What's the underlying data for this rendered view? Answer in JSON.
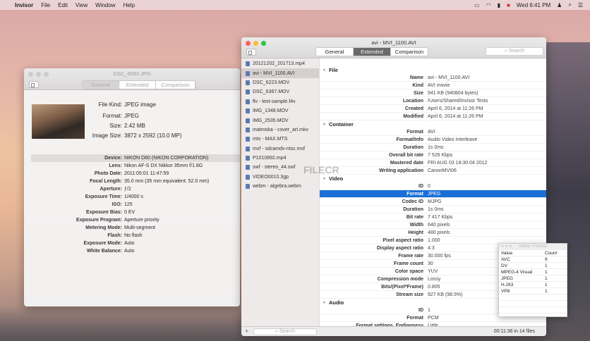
{
  "menubar": {
    "app": "Invisor",
    "items": [
      "File",
      "Edit",
      "View",
      "Window",
      "Help"
    ],
    "clock": "Wed 6:41 PM"
  },
  "left_window": {
    "title": "DSC_6093.JPG",
    "tabs": [
      "General",
      "Extended",
      "Comparison"
    ],
    "summary": [
      {
        "k": "File Kind:",
        "v": "JPEG image"
      },
      {
        "k": "Format:",
        "v": "JPEG"
      },
      {
        "k": "Size:",
        "v": "2.42 MB"
      },
      {
        "k": "Image Size:",
        "v": "3872 x 2592 (10.0 MP)"
      }
    ],
    "exif": [
      {
        "k": "Device:",
        "v": "NIKON D60 (NIKON CORPORATION)"
      },
      {
        "k": "Lens:",
        "v": "Nikon AF-S DX Nikkor 35mm f/1.8G"
      },
      {
        "k": "Photo Date:",
        "v": "2011:05:01 11:47:59"
      },
      {
        "k": "Focal Length:",
        "v": "35.0 mm (35 mm equivalent: 52.0 mm)"
      },
      {
        "k": "Aperture:",
        "v": "ƒ/2"
      },
      {
        "k": "Exposure Time:",
        "v": "1/4000 s"
      },
      {
        "k": "ISO:",
        "v": "125"
      },
      {
        "k": "Exposure Bias:",
        "v": "0 EV"
      },
      {
        "k": "Exposure Program:",
        "v": "Aperture priority"
      },
      {
        "k": "Metering Mode:",
        "v": "Multi-segment"
      },
      {
        "k": "Flash:",
        "v": "No flash"
      },
      {
        "k": "Exposure Mode:",
        "v": "Auto"
      },
      {
        "k": "White Balance:",
        "v": "Auto"
      }
    ]
  },
  "main_window": {
    "title": "avi - MVI_1100.AVI",
    "tabs": [
      "General",
      "Extended",
      "Comparison"
    ],
    "search_placeholder": "Search",
    "files": [
      "20121202_201713.mp4",
      "avi - MVI_1100.AVI",
      "DSC_6223.MOV",
      "DSC_6367.MOV",
      "flv - test-sample.f4v",
      "IMG_1348.MOV",
      "IMG_2535.MOV",
      "matroska - cover_art.mkv",
      "mts - MAX.MTS",
      "mxf - sdcamdv-ntsc.mxf",
      "P1010892.mp4",
      "swf - stereo_44.swf",
      "VIDEO0010.3gp",
      "webm - algebra.webm"
    ],
    "sidebar_search_placeholder": "Search",
    "status": "00:11:36 in 14 files",
    "sections": [
      {
        "name": "File",
        "rows": [
          {
            "k": "Name",
            "v": "avi - MVI_1100.AVI"
          },
          {
            "k": "Kind",
            "v": "AVI movie"
          },
          {
            "k": "Size",
            "v": "941 KB (940804 bytes)"
          },
          {
            "k": "Location",
            "v": "/Users/Shared/Invisor Tests"
          },
          {
            "k": "Created",
            "v": "April 6, 2014 at 11:26 PM"
          },
          {
            "k": "Modified",
            "v": "April 6, 2014 at 11:26 PM"
          }
        ]
      },
      {
        "name": "Container",
        "rows": [
          {
            "k": "Format",
            "v": "AVI"
          },
          {
            "k": "Format/Info",
            "v": "Audio Video Interleave"
          },
          {
            "k": "Duration",
            "v": "1s 0ms"
          },
          {
            "k": "Overall bit rate",
            "v": "7 526 Kbps"
          },
          {
            "k": "Mastered date",
            "v": "FRI AUG 03 18:30:04 2012"
          },
          {
            "k": "Writing application",
            "v": "CanonMVI06"
          }
        ]
      },
      {
        "name": "Video",
        "rows": [
          {
            "k": "ID",
            "v": "0"
          },
          {
            "k": "Format",
            "v": "JPEG"
          },
          {
            "k": "Codec ID",
            "v": "MJPG"
          },
          {
            "k": "Duration",
            "v": "1s 0ms"
          },
          {
            "k": "Bit rate",
            "v": "7 417 Kbps"
          },
          {
            "k": "Width",
            "v": "640 pixels"
          },
          {
            "k": "Height",
            "v": "480 pixels"
          },
          {
            "k": "Pixel aspect ratio",
            "v": "1.000"
          },
          {
            "k": "Display aspect ratio",
            "v": "4:3"
          },
          {
            "k": "Frame rate",
            "v": "30.000 fps"
          },
          {
            "k": "Frame count",
            "v": "30"
          },
          {
            "k": "Color space",
            "v": "YUV"
          },
          {
            "k": "Compression mode",
            "v": "Lossy"
          },
          {
            "k": "Bits/(Pixel*Frame)",
            "v": "0.805"
          },
          {
            "k": "Stream size",
            "v": "927 KB (98.5%)"
          }
        ]
      },
      {
        "name": "Audio",
        "rows": [
          {
            "k": "ID",
            "v": "1"
          },
          {
            "k": "Format",
            "v": "PCM"
          },
          {
            "k": "Format settings, Endianness",
            "v": "Little"
          }
        ]
      }
    ]
  },
  "panel": {
    "title": "Video: Format",
    "headers": [
      "Value",
      "Count"
    ],
    "rows": [
      [
        "AVC",
        "9"
      ],
      [
        "DV",
        "1"
      ],
      [
        "MPEG-4 Visual",
        "1"
      ],
      [
        "JPEG",
        "1"
      ],
      [
        "H.263",
        "1"
      ],
      [
        "VP8",
        "1"
      ]
    ]
  },
  "watermark": "FILECR"
}
